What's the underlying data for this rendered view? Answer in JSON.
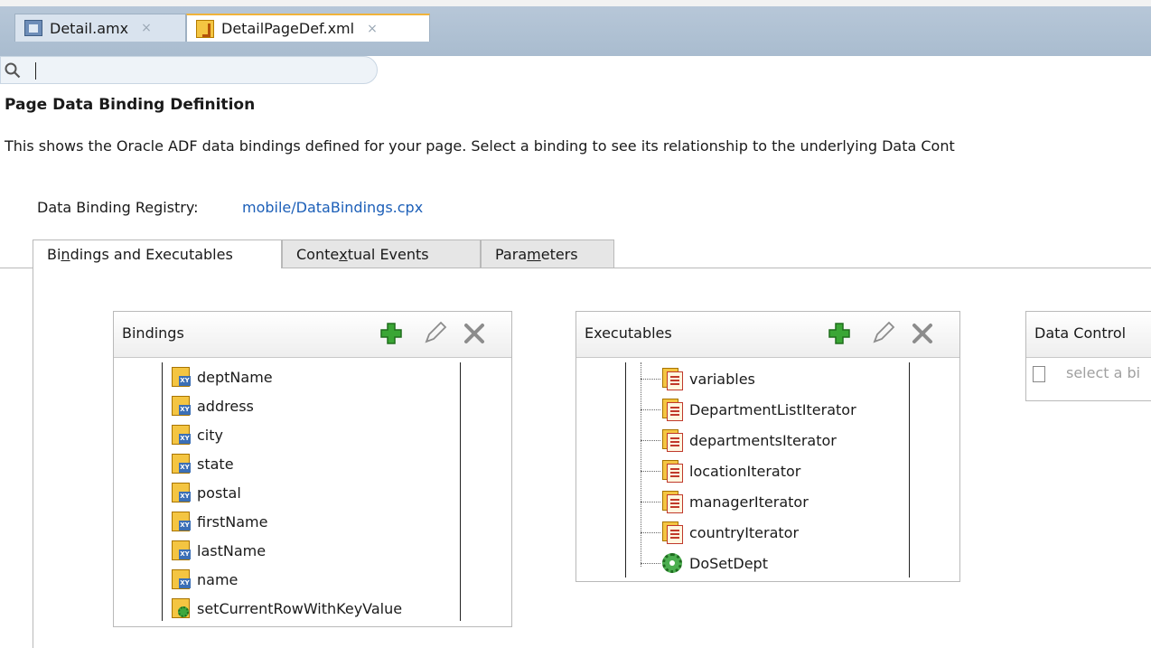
{
  "editor_tabs": [
    {
      "label": "Detail.amx",
      "close": "×"
    },
    {
      "label": "DetailPageDef.xml",
      "close": "×"
    }
  ],
  "search": {
    "placeholder": ""
  },
  "page": {
    "heading": "Page Data Binding Definition",
    "description": "This shows the Oracle ADF data bindings defined for your page. Select a binding to see its relationship to the underlying Data Cont",
    "registry_label": "Data Binding Registry:",
    "registry_link": "mobile/DataBindings.cpx"
  },
  "view_tabs": [
    {
      "pre": "Bi",
      "accel": "n",
      "post": "dings and Executables"
    },
    {
      "pre": "Conte",
      "accel": "x",
      "post": "tual Events"
    },
    {
      "pre": "Para",
      "accel": "m",
      "post": "eters"
    }
  ],
  "bindings": {
    "title": "Bindings",
    "items": [
      "deptName",
      "address",
      "city",
      "state",
      "postal",
      "firstName",
      "lastName",
      "name",
      "setCurrentRowWithKeyValue"
    ]
  },
  "executables": {
    "title": "Executables",
    "items": [
      "variables",
      "DepartmentListIterator",
      "departmentsIterator",
      "locationIterator",
      "managerIterator",
      "countryIterator",
      "DoSetDept"
    ]
  },
  "data_control": {
    "title": "Data Control",
    "hint": "select a bi"
  },
  "icons": {
    "add": "plus-icon",
    "edit": "pencil-icon",
    "delete": "x-icon",
    "attribute_binding": "attribute-binding-icon",
    "method_binding": "method-binding-icon",
    "iterator": "iterator-icon",
    "invoke_action": "gear-icon"
  },
  "colors": {
    "link": "#1c5fb8",
    "tab_accent": "#f0b33a",
    "add_green": "#3aa635"
  }
}
